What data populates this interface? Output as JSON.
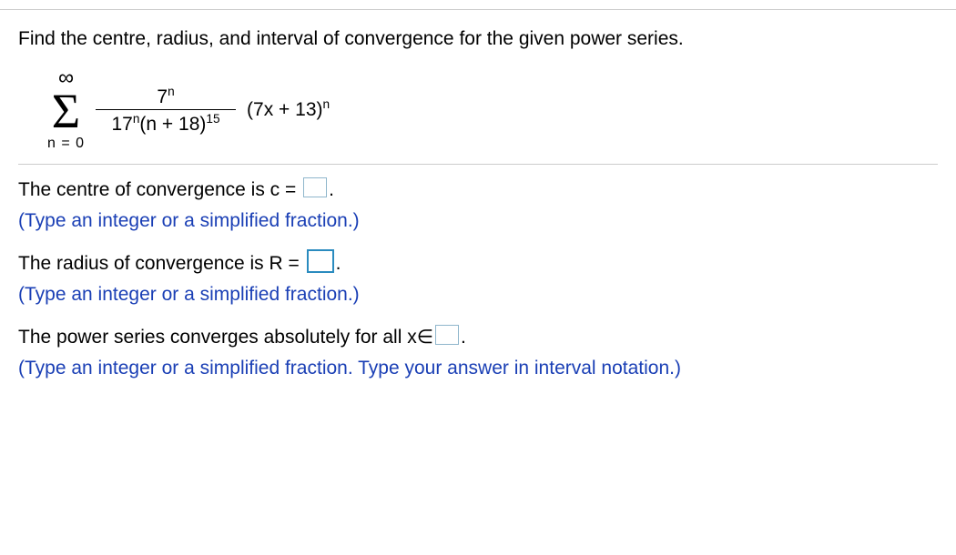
{
  "prompt": "Find the centre, radius, and interval of convergence for the given power series.",
  "formula": {
    "sigma_top": "∞",
    "sigma_bottom": "n = 0",
    "numerator_base": "7",
    "numerator_exp": "n",
    "denom_left_base": "17",
    "denom_left_exp": "n",
    "denom_paren": "(n + 18)",
    "denom_paren_exp": "15",
    "factor_paren": "(7x + 13)",
    "factor_exp": "n"
  },
  "q1": {
    "pre": "The centre of convergence is c =",
    "post": ".",
    "hint": "(Type an integer or a simplified fraction.)"
  },
  "q2": {
    "pre": "The radius of convergence is R =",
    "post": ".",
    "hint": "(Type an integer or a simplified fraction.)"
  },
  "q3": {
    "pre": "The power series converges absolutely for all x∈",
    "post": ".",
    "hint": "(Type an integer or a simplified fraction. Type your answer in interval notation.)"
  }
}
